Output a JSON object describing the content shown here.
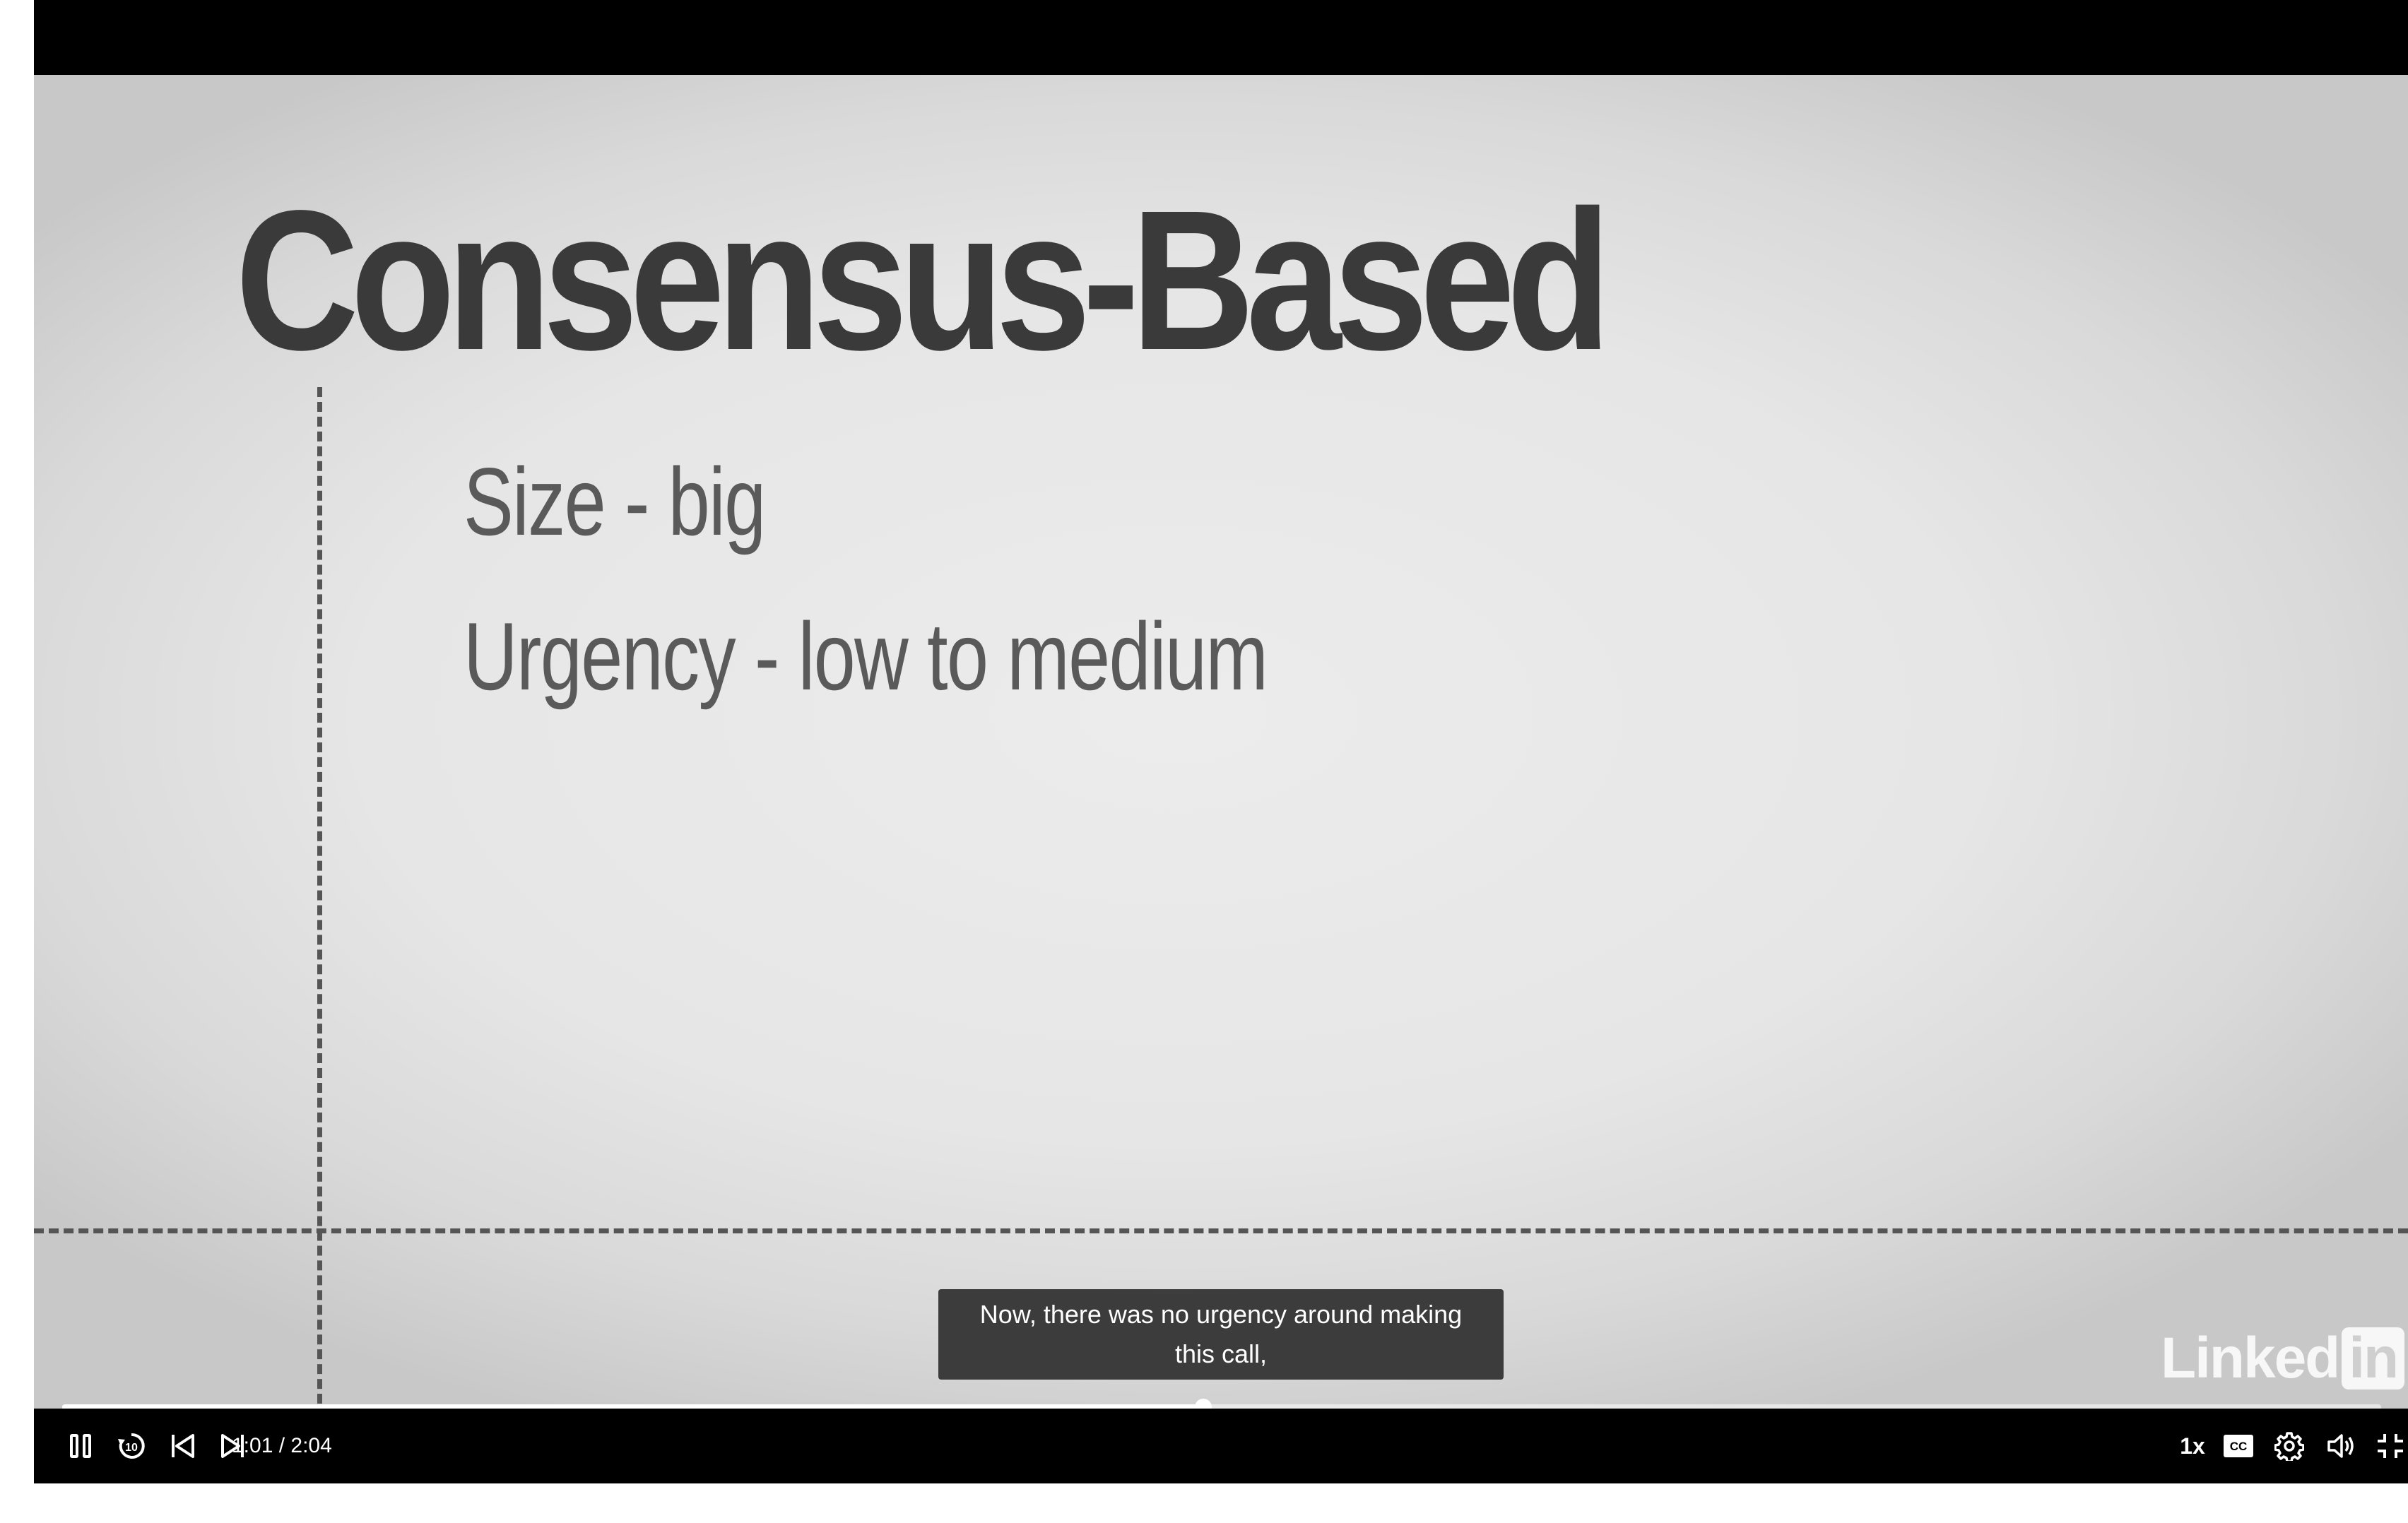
{
  "slide": {
    "title": "Consensus-Based",
    "lines": [
      "Size - big",
      "Urgency - low to medium"
    ]
  },
  "caption": {
    "line1": "Now, there was no urgency around making",
    "line2": "this call,"
  },
  "watermark": {
    "text_prefix": "Linked",
    "text_box": "in"
  },
  "player": {
    "current_time": "1:01",
    "duration": "2:04",
    "time_display": "1:01 / 2:04",
    "progress_fraction": 0.492,
    "speed_label": "1x",
    "rewind_seconds": "10",
    "controls": {
      "pause": "pause-icon",
      "rewind": "rewind-10-icon",
      "previous": "skip-previous-icon",
      "next": "skip-next-icon",
      "captions": "closed-captions-icon",
      "settings": "gear-icon",
      "volume": "volume-icon",
      "fullscreen": "exit-fullscreen-icon"
    }
  },
  "colors": {
    "slide_text": "#3a3a3a",
    "caption_bg": "#343434",
    "control_bar": "#000000"
  }
}
